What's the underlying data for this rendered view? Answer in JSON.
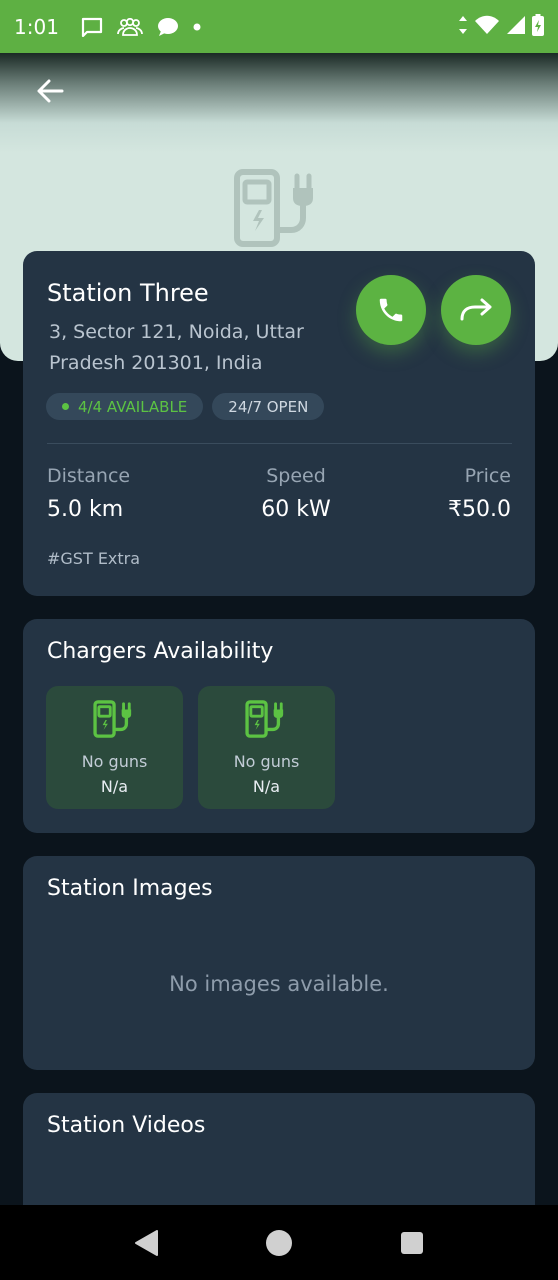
{
  "status_bar": {
    "time": "1:01",
    "icons": [
      "chat-icon",
      "group-icon",
      "message-bubble-icon",
      "dot-icon"
    ],
    "right_icons": [
      "data-arrows-icon",
      "wifi-icon",
      "signal-icon",
      "battery-icon"
    ]
  },
  "header": {
    "back_icon": "arrow-left-icon",
    "hero_icon": "ev-charger-icon"
  },
  "station": {
    "name": "Station Three",
    "address": "3, Sector 121, Noida, Uttar Pradesh 201301, India",
    "call_icon": "phone-icon",
    "directions_icon": "share-arrow-icon",
    "availability_badge": "4/4 AVAILABLE",
    "hours_badge": "24/7 OPEN",
    "stats": {
      "distance_label": "Distance",
      "distance_value": "5.0 km",
      "speed_label": "Speed",
      "speed_value": "60 kW",
      "price_label": "Price",
      "price_value": "₹50.0"
    },
    "gst_note": "#GST Extra"
  },
  "chargers": {
    "title": "Chargers Availability",
    "items": [
      {
        "label": "No guns",
        "value": "N/a"
      },
      {
        "label": "No guns",
        "value": "N/a"
      }
    ]
  },
  "images": {
    "title": "Station Images",
    "empty_message": "No images available."
  },
  "videos": {
    "title": "Station Videos"
  },
  "nav_bar": {
    "buttons": [
      "back-triangle-icon",
      "home-circle-icon",
      "recents-square-icon"
    ]
  },
  "colors": {
    "accent": "#5cb342",
    "status_bar": "#5eb043",
    "card_bg": "#243444",
    "page_bg": "#0b141c"
  }
}
